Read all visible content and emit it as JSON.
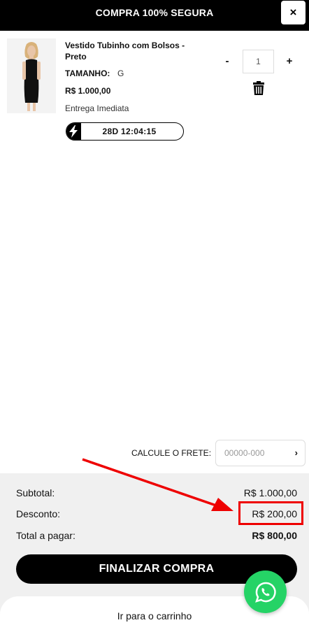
{
  "header": {
    "title": "COMPRA 100% SEGURA",
    "close_label": "×"
  },
  "item": {
    "name": "Vestido Tubinho com Bolsos - Preto",
    "size_label": "TAMANHO:",
    "size_value": "G",
    "price": "R$ 1.000,00",
    "delivery": "Entrega Imediata",
    "timer": "28D 12:04:15",
    "quantity": "1",
    "minus_label": "-",
    "plus_label": "+"
  },
  "shipping": {
    "label": "CALCULE O FRETE:",
    "placeholder": "00000-000",
    "go_label": "›"
  },
  "summary": {
    "subtotal_label": "Subtotal:",
    "subtotal_value": "R$ 1.000,00",
    "discount_label": "Desconto:",
    "discount_value": "R$ 200,00",
    "total_label": "Total a pagar:",
    "total_value": "R$ 800,00"
  },
  "actions": {
    "checkout_label": "FINALIZAR COMPRA",
    "cart_label": "Ir para o carrinho"
  },
  "colors": {
    "accent": "#000000",
    "whatsapp": "#25d366",
    "annotation": "#e00000"
  },
  "icons": [
    "close-icon",
    "lightning-icon",
    "trash-icon",
    "chevron-right-icon",
    "whatsapp-icon",
    "arrow-annotation"
  ]
}
